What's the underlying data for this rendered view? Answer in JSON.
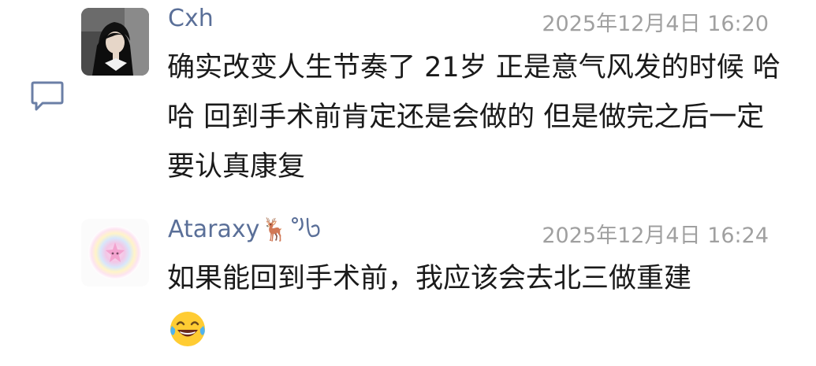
{
  "comments": [
    {
      "username": "Cxh",
      "timestamp": "2025年12月4日 16:20",
      "text": "确实改变人生节奏了 21岁 正是意气风发的时候 哈哈 回到手术前肯定还是会做的 但是做完之后一定要认真康复"
    },
    {
      "username": "Ataraxy",
      "username_decoration": "🦌°ᥫ᭡",
      "timestamp": "2025年12月4日 16:24",
      "text": "如果能回到手术前，我应该会去北三做重建",
      "emoji": "😂"
    }
  ],
  "colors": {
    "username": "#5a6f98",
    "timestamp": "#a0a0a0",
    "text": "#1a1a1a",
    "reply_icon": "#6b7fa6"
  }
}
